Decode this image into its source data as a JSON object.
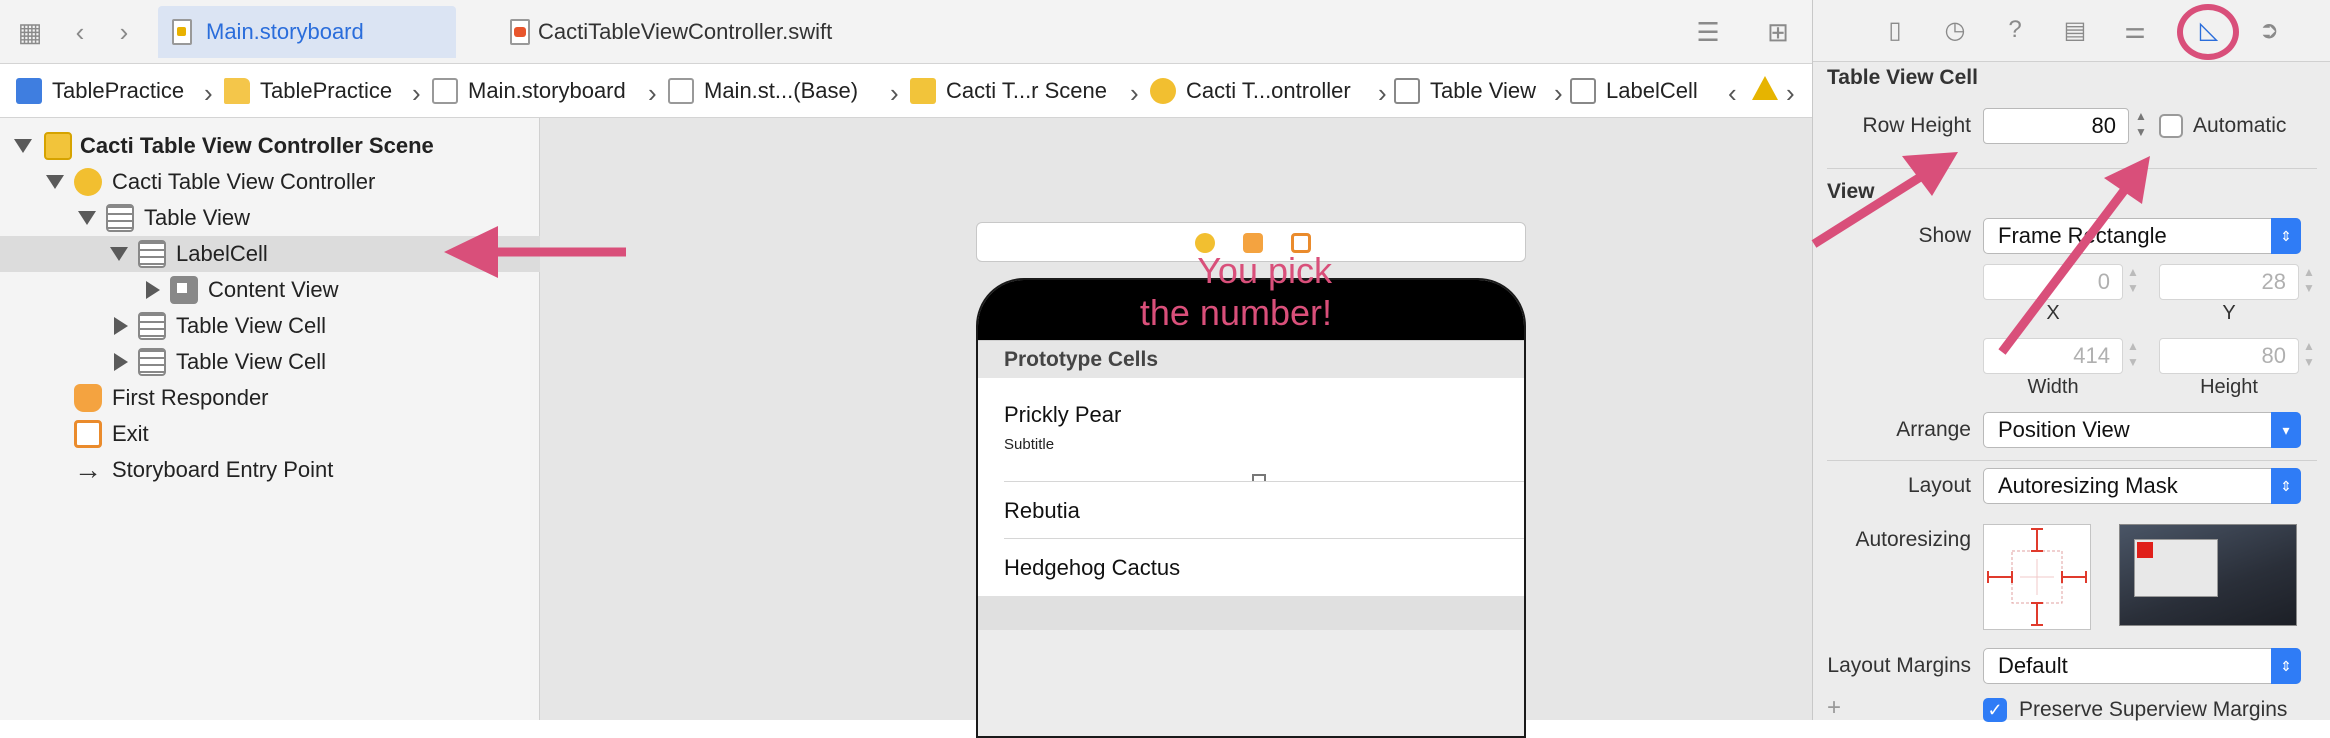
{
  "tabs": [
    {
      "label": "Main.storyboard",
      "active": true
    },
    {
      "label": "CactiTableViewController.swift",
      "active": false
    }
  ],
  "breadcrumbs": [
    "TablePractice",
    "TablePractice",
    "Main.storyboard",
    "Main.st...(Base)",
    "Cacti T...r Scene",
    "Cacti T...ontroller",
    "Table View",
    "LabelCell"
  ],
  "navigator": {
    "items": [
      {
        "label": "Cacti Table View Controller Scene"
      },
      {
        "label": "Cacti Table View Controller"
      },
      {
        "label": "Table View"
      },
      {
        "label": "LabelCell"
      },
      {
        "label": "Content View"
      },
      {
        "label": "Table View Cell"
      },
      {
        "label": "Table View Cell"
      },
      {
        "label": "First Responder"
      },
      {
        "label": "Exit"
      },
      {
        "label": "Storyboard Entry Point"
      }
    ]
  },
  "canvas": {
    "section_header": "Prototype Cells",
    "cells": [
      {
        "title": "Prickly Pear",
        "subtitle": "Subtitle"
      },
      {
        "title": "Rebutia"
      },
      {
        "title": "Hedgehog Cactus"
      }
    ],
    "annotation_line1": "You pick",
    "annotation_line2": "the number!"
  },
  "inspector": {
    "section_cell": "Table View Cell",
    "row_height_label": "Row Height",
    "row_height_value": "80",
    "automatic_label": "Automatic",
    "automatic_checked": false,
    "section_view": "View",
    "show_label": "Show",
    "show_value": "Frame Rectangle",
    "x_value": "0",
    "y_value": "28",
    "x_label": "X",
    "y_label": "Y",
    "width_value": "414",
    "height_value": "80",
    "width_label": "Width",
    "height_label": "Height",
    "arrange_label": "Arrange",
    "arrange_value": "Position View",
    "layout_label": "Layout",
    "layout_value": "Autoresizing Mask",
    "autoresizing_label": "Autoresizing",
    "layout_margins_label": "Layout Margins",
    "layout_margins_value": "Default",
    "preserve_label": "Preserve Superview Margins",
    "preserve_checked": true
  },
  "colors": {
    "accent": "#2f7cf6",
    "annotation": "#d94f7a"
  }
}
